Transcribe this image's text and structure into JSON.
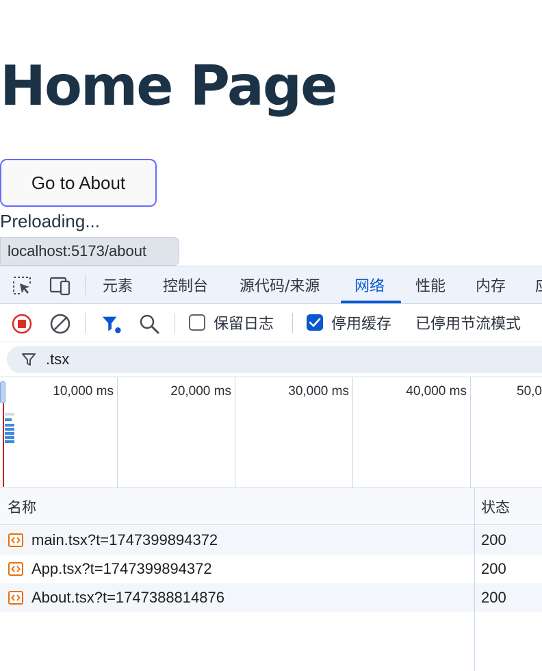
{
  "page": {
    "title": "Home Page",
    "about_button": "Go to About",
    "preloading_text": "Preloading...",
    "link_preview_url": "localhost:5173/about"
  },
  "devtools": {
    "tools": [
      {
        "icon": "element-picker-icon"
      },
      {
        "icon": "device-toolbar-icon"
      }
    ],
    "tabs": [
      {
        "label": "元素",
        "active": false
      },
      {
        "label": "控制台",
        "active": false
      },
      {
        "label": "源代码/来源",
        "active": false
      },
      {
        "label": "网络",
        "active": true
      },
      {
        "label": "性能",
        "active": false
      },
      {
        "label": "内存",
        "active": false
      },
      {
        "label": "应",
        "active": false
      }
    ],
    "toolbar": {
      "record_icon": "stop-recording-icon",
      "clear_icon": "clear-icon",
      "filter_icon": "filter-icon",
      "search_icon": "search-icon",
      "preserve_log_label": "保留日志",
      "preserve_log_checked": false,
      "disable_cache_label": "停用缓存",
      "disable_cache_checked": true,
      "throttling_label": "已停用节流模式"
    },
    "filter": {
      "value": ".tsx"
    },
    "timeline": {
      "tick_labels": [
        "10,000 ms",
        "20,000 ms",
        "30,000 ms",
        "40,000 ms",
        "50,0"
      ]
    },
    "table": {
      "columns": [
        "名称",
        "状态"
      ],
      "rows": [
        {
          "name": "main.tsx?t=1747399894372",
          "status": "200"
        },
        {
          "name": "App.tsx?t=1747399894372",
          "status": "200"
        },
        {
          "name": "About.tsx?t=1747388814876",
          "status": "200"
        }
      ]
    }
  },
  "colors": {
    "accent": "#0b57d0",
    "button_border": "#646cff",
    "title": "#1c3347",
    "record_red": "#d93025",
    "file_icon_orange": "#e8710a"
  }
}
